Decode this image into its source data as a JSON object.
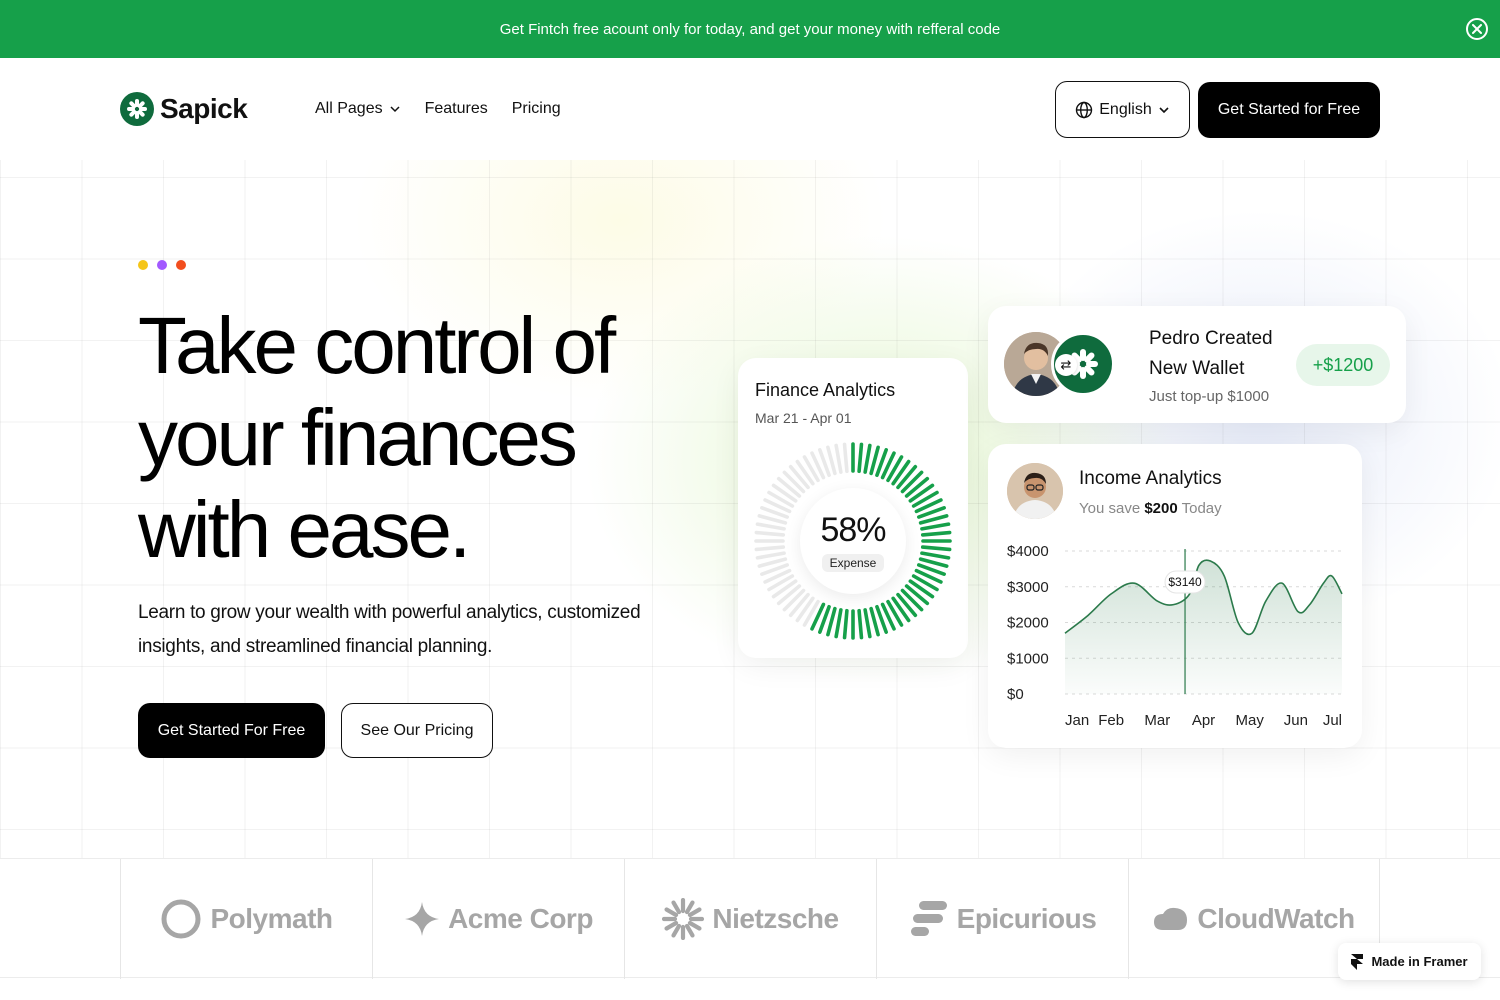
{
  "announcement": {
    "text": "Get Fintch free acount only for today, and get your money with refferal code",
    "close_icon": "close-circle-icon",
    "bg_color": "#16a04a"
  },
  "nav": {
    "brand": "Sapick",
    "brand_color": "#0f6b3d",
    "links": [
      {
        "label": "All Pages",
        "has_dropdown": true
      },
      {
        "label": "Features",
        "has_dropdown": false
      },
      {
        "label": "Pricing",
        "has_dropdown": false
      }
    ],
    "language": "English",
    "language_icon": "globe-icon",
    "cta": "Get Started for Free"
  },
  "hero": {
    "dot_colors": [
      "#f5c518",
      "#a259ff",
      "#f24e1e"
    ],
    "headline": "Take control of your finances with ease.",
    "subcopy": "Learn to grow your wealth with powerful analytics, customized insights, and streamlined financial planning.",
    "primary_cta": "Get Started For Free",
    "secondary_cta": "See Our Pricing"
  },
  "finance_card": {
    "title": "Finance Analytics",
    "date_range": "Mar 21 - Apr 01",
    "percent_value": 58,
    "percent_label": "58%",
    "tag": "Expense",
    "accent_color": "#16a04a"
  },
  "wallet_card": {
    "title": "Pedro Created New Wallet",
    "subtitle": "Just top-up $1000",
    "amount": "+$1200",
    "swap_icon": "swap-icon"
  },
  "income_card": {
    "title": "Income Analytics",
    "sub_prefix": "You save",
    "sub_amount": "$200",
    "sub_suffix": "Today"
  },
  "chart_data": {
    "type": "area",
    "title": "Income Analytics",
    "x": [
      "Jan",
      "Feb",
      "Mar",
      "Apr",
      "May",
      "Jun",
      "Jul"
    ],
    "y_ticks": [
      "$4000",
      "$3000",
      "$2000",
      "$1000",
      "$0"
    ],
    "ylim": [
      0,
      4000
    ],
    "series": [
      {
        "points": [
          [
            0.0,
            1700
          ],
          [
            0.5,
            2200
          ],
          [
            1.0,
            2800
          ],
          [
            1.5,
            3100
          ],
          [
            2.0,
            2600
          ],
          [
            2.35,
            2500
          ],
          [
            2.7,
            2800
          ],
          [
            2.9,
            3600
          ],
          [
            3.15,
            3720
          ],
          [
            3.45,
            3300
          ],
          [
            3.75,
            2000
          ],
          [
            4.05,
            1700
          ],
          [
            4.35,
            2600
          ],
          [
            4.7,
            3100
          ],
          [
            5.05,
            2300
          ],
          [
            5.3,
            2500
          ],
          [
            5.6,
            3100
          ],
          [
            5.78,
            3300
          ],
          [
            6.0,
            2800
          ]
        ]
      }
    ],
    "highlight": {
      "x_index": 2.6,
      "label": "$3140"
    },
    "grid": true,
    "line_color": "#2b7a4b"
  },
  "logos": [
    {
      "name": "Polymath",
      "icon": "ring-icon"
    },
    {
      "name": "Acme Corp",
      "icon": "sparkle-icon"
    },
    {
      "name": "Nietzsche",
      "icon": "sunburst-icon"
    },
    {
      "name": "Epicurious",
      "icon": "stacked-bars-icon"
    },
    {
      "name": "CloudWatch",
      "icon": "cloud-icon"
    }
  ],
  "framer_badge": {
    "label": "Made in Framer",
    "icon": "framer-icon"
  }
}
